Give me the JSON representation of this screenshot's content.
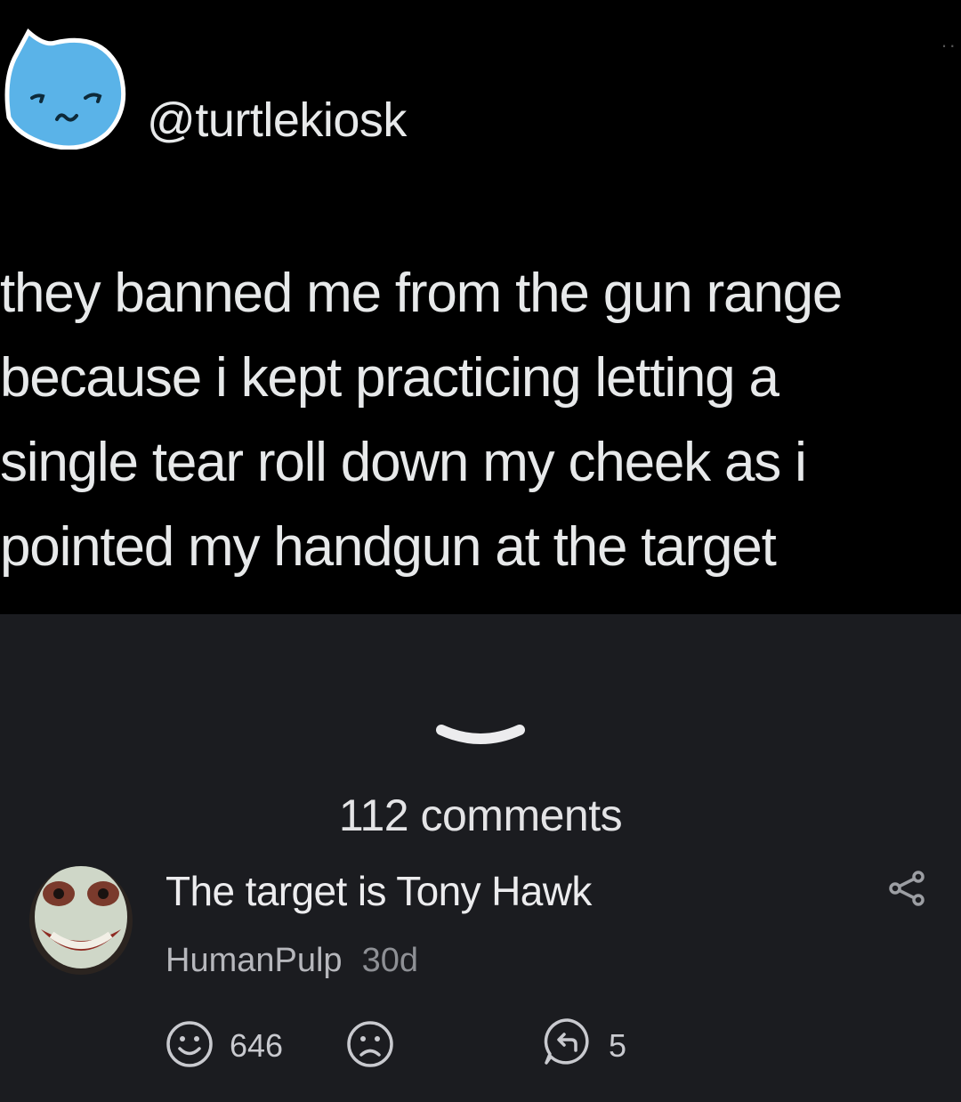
{
  "tweet": {
    "handle": "@turtlekiosk",
    "more_icon": "ellipsis-icon",
    "text_lines": [
      "they banned me from the gun range",
      "because i kept practicing letting a",
      "single tear roll down my cheek as i",
      "pointed my handgun at the target"
    ],
    "avatar_icon": "cartoon-cat-avatar"
  },
  "post": {
    "collapse_icon": "chevron-down-icon",
    "comments_label": "112 comments"
  },
  "comment": {
    "text": "The target is Tony Hawk",
    "author": "HumanPulp",
    "age": "30d",
    "avatar_icon": "user-avatar",
    "share_icon": "share-icon",
    "likes_count": "646",
    "replies_count": "5",
    "like_icon": "smile-icon",
    "dislike_icon": "frown-icon",
    "reply_icon": "reply-bubble-icon"
  },
  "colors": {
    "tweet_bg": "#000000",
    "app_bg": "#1b1c20",
    "text_primary": "#e7e9ea",
    "text_secondary": "#b6b7bc",
    "avatar_blue": "#5ab3e8"
  }
}
